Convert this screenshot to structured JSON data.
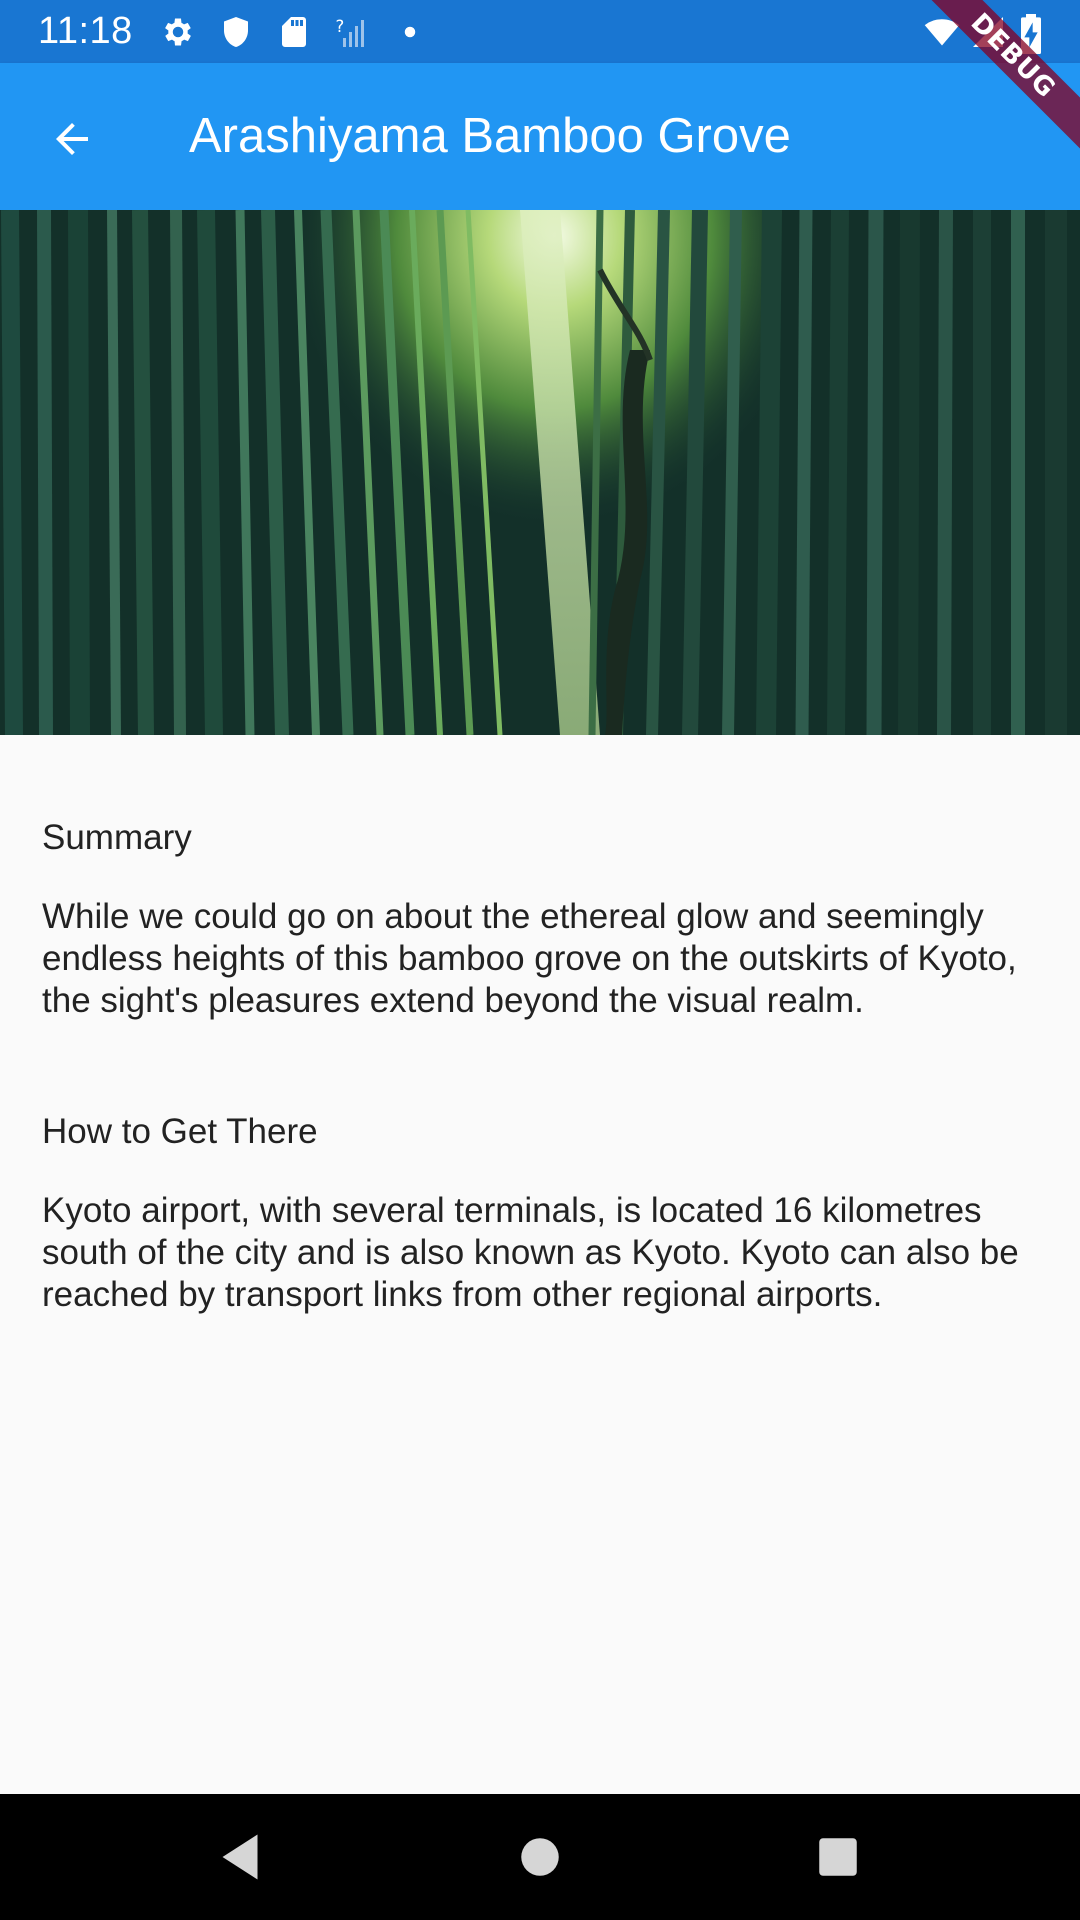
{
  "status_bar": {
    "time": "11:18",
    "left_icons": [
      "settings-icon",
      "shield-icon",
      "sd-card-icon",
      "no-signal-icon",
      "dot-icon"
    ],
    "right_icons": [
      "wifi-icon",
      "cell-signal-icon",
      "battery-charging-icon"
    ]
  },
  "app_bar": {
    "back_icon": "arrow-back-icon",
    "title": "Arashiyama Bamboo Grove",
    "color": "#2196f3"
  },
  "debug_banner": {
    "label": "DEBUG"
  },
  "hero_image": {
    "subject": "bamboo-grove-photo"
  },
  "sections": [
    {
      "heading": "Summary",
      "text": "While we could go on about the ethereal glow and seemingly endless heights of this bamboo grove on the outskirts of Kyoto, the sight's pleasures extend beyond the visual realm."
    },
    {
      "heading": "How to Get There",
      "text": "Kyoto airport, with several terminals, is located 16 kilometres south of the city and is also known as Kyoto. Kyoto can also be reached by transport links from other regional airports."
    }
  ],
  "nav_bar": {
    "buttons": [
      "back-triangle-icon",
      "home-circle-icon",
      "recents-square-icon"
    ]
  },
  "colors": {
    "status_bar": "#1976d2",
    "app_bar": "#2196f3",
    "background": "#fafafa"
  }
}
